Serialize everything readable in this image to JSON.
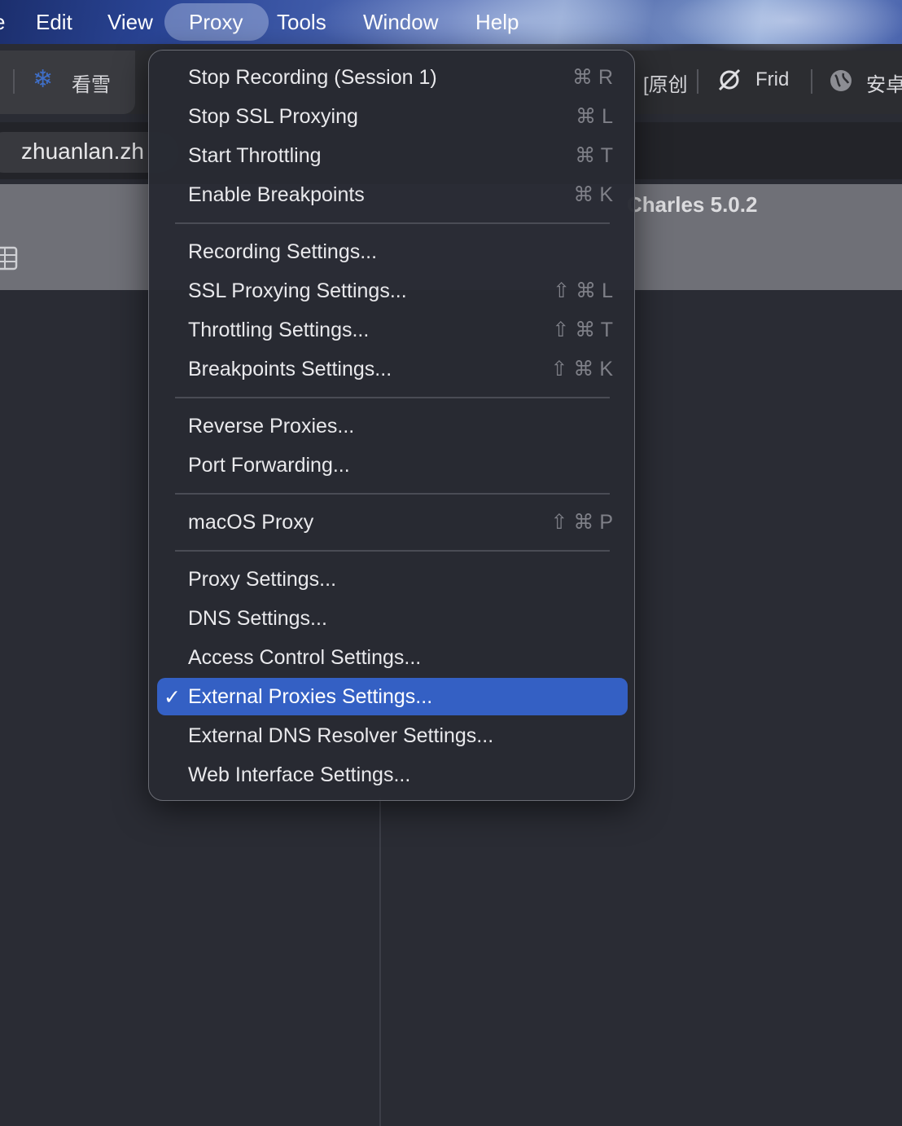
{
  "menubar": {
    "items": [
      "Edit",
      "View",
      "Proxy",
      "Tools",
      "Window",
      "Help"
    ],
    "active": "Proxy"
  },
  "browser": {
    "tabs": [
      "看雪",
      "[原创",
      "Frid",
      "安卓"
    ],
    "url": "zhuanlan.zh",
    "app_title": "Charles 5.0.2"
  },
  "proxy_menu": {
    "groups": [
      [
        {
          "label": "Stop Recording (Session 1)",
          "shortcut": "⌘ R"
        },
        {
          "label": "Stop SSL Proxying",
          "shortcut": "⌘ L"
        },
        {
          "label": "Start Throttling",
          "shortcut": "⌘ T"
        },
        {
          "label": "Enable Breakpoints",
          "shortcut": "⌘ K"
        }
      ],
      [
        {
          "label": "Recording Settings...",
          "shortcut": ""
        },
        {
          "label": "SSL Proxying Settings...",
          "shortcut": "⇧ ⌘ L"
        },
        {
          "label": "Throttling Settings...",
          "shortcut": "⇧ ⌘ T"
        },
        {
          "label": "Breakpoints Settings...",
          "shortcut": "⇧ ⌘ K"
        }
      ],
      [
        {
          "label": "Reverse Proxies...",
          "shortcut": ""
        },
        {
          "label": "Port Forwarding...",
          "shortcut": ""
        }
      ],
      [
        {
          "label": "macOS Proxy",
          "shortcut": "⇧ ⌘ P"
        }
      ],
      [
        {
          "label": "Proxy Settings...",
          "shortcut": ""
        },
        {
          "label": "DNS Settings...",
          "shortcut": ""
        },
        {
          "label": "Access Control Settings...",
          "shortcut": ""
        },
        {
          "label": "External Proxies Settings...",
          "shortcut": "",
          "checked": true,
          "highlighted": true
        },
        {
          "label": "External DNS Resolver Settings...",
          "shortcut": ""
        },
        {
          "label": "Web Interface Settings...",
          "shortcut": ""
        }
      ]
    ],
    "colors": {
      "highlight": "#3460c4",
      "background": "#282a33"
    }
  }
}
